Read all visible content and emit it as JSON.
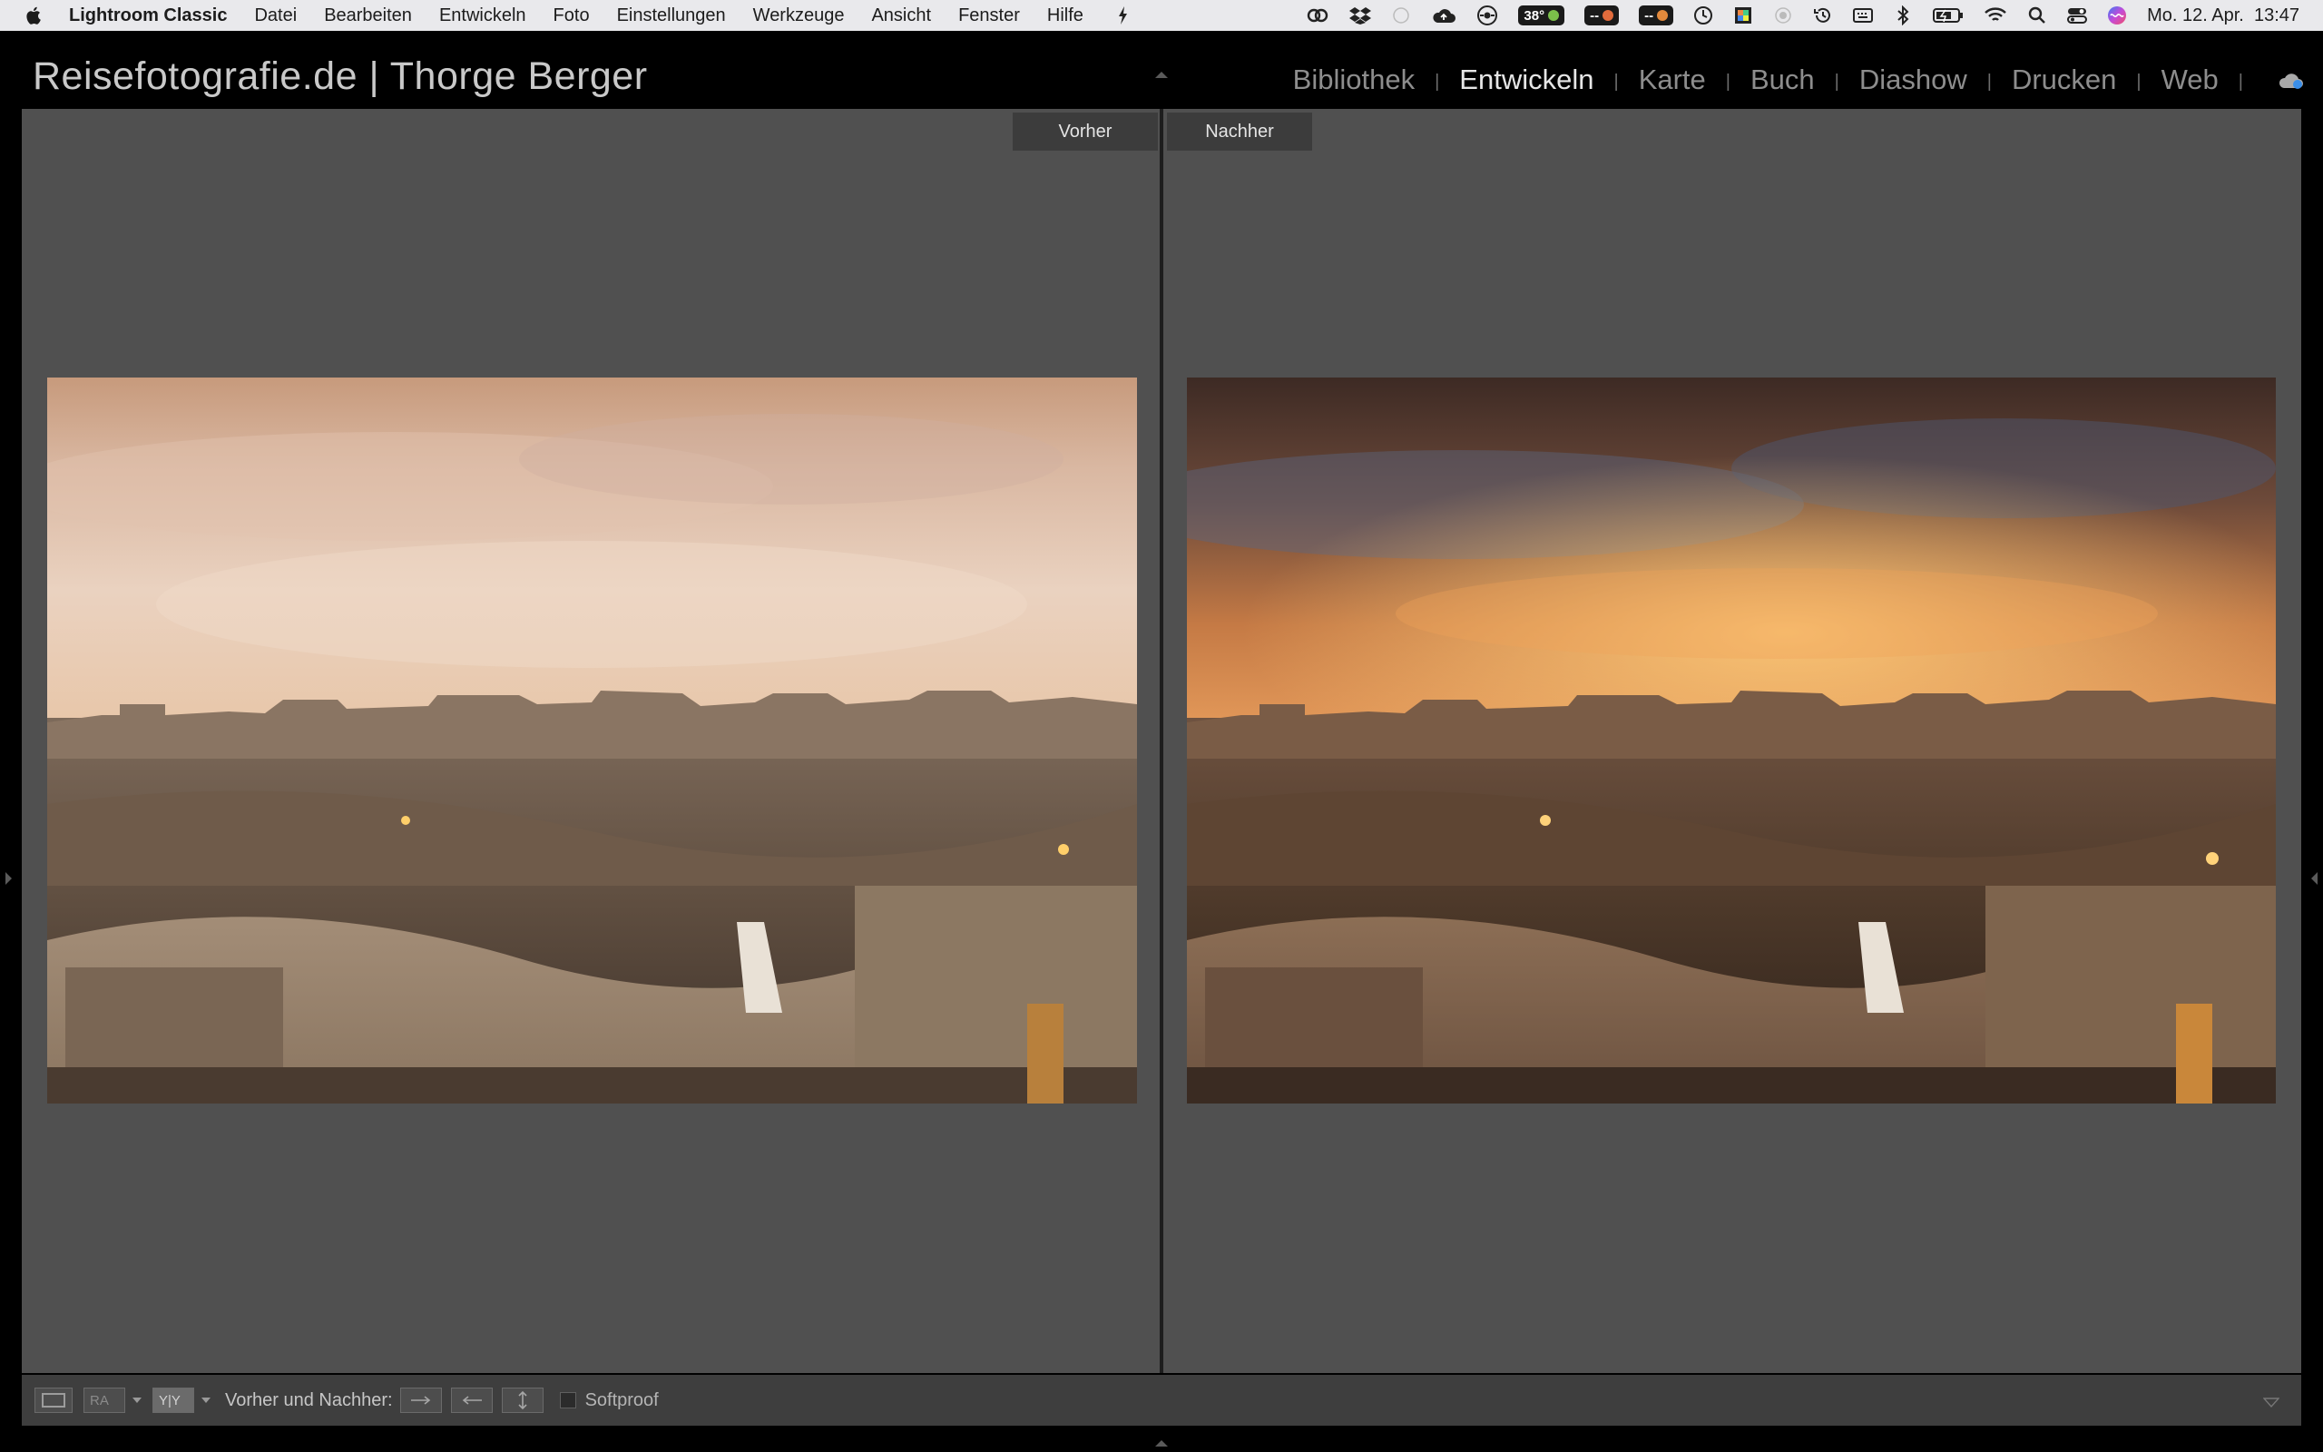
{
  "menubar": {
    "app_name": "Lightroom Classic",
    "menus": [
      "Datei",
      "Bearbeiten",
      "Entwickeln",
      "Foto",
      "Einstellungen",
      "Werkzeuge",
      "Ansicht",
      "Fenster",
      "Hilfe"
    ],
    "temperature": "38°",
    "indicator_a": "--",
    "indicator_b": "--",
    "clock": "Mo. 12. Apr.  13:47"
  },
  "identity_plate": "Reisefotografie.de | Thorge Berger",
  "modules": {
    "library": "Bibliothek",
    "develop": "Entwickeln",
    "map": "Karte",
    "book": "Buch",
    "slideshow": "Diashow",
    "print": "Drucken",
    "web": "Web",
    "active": "develop",
    "separator": "|"
  },
  "compare": {
    "before_label": "Vorher",
    "after_label": "Nachher"
  },
  "toolbar": {
    "before_after_label": "Vorher und Nachher:",
    "softproof_label": "Softproof",
    "softproof_checked": false
  },
  "colors": {
    "background": "#505050",
    "panel": "#3e3e3e",
    "active_module": "#e6e6e6",
    "inactive_module": "#8d8d8d"
  }
}
